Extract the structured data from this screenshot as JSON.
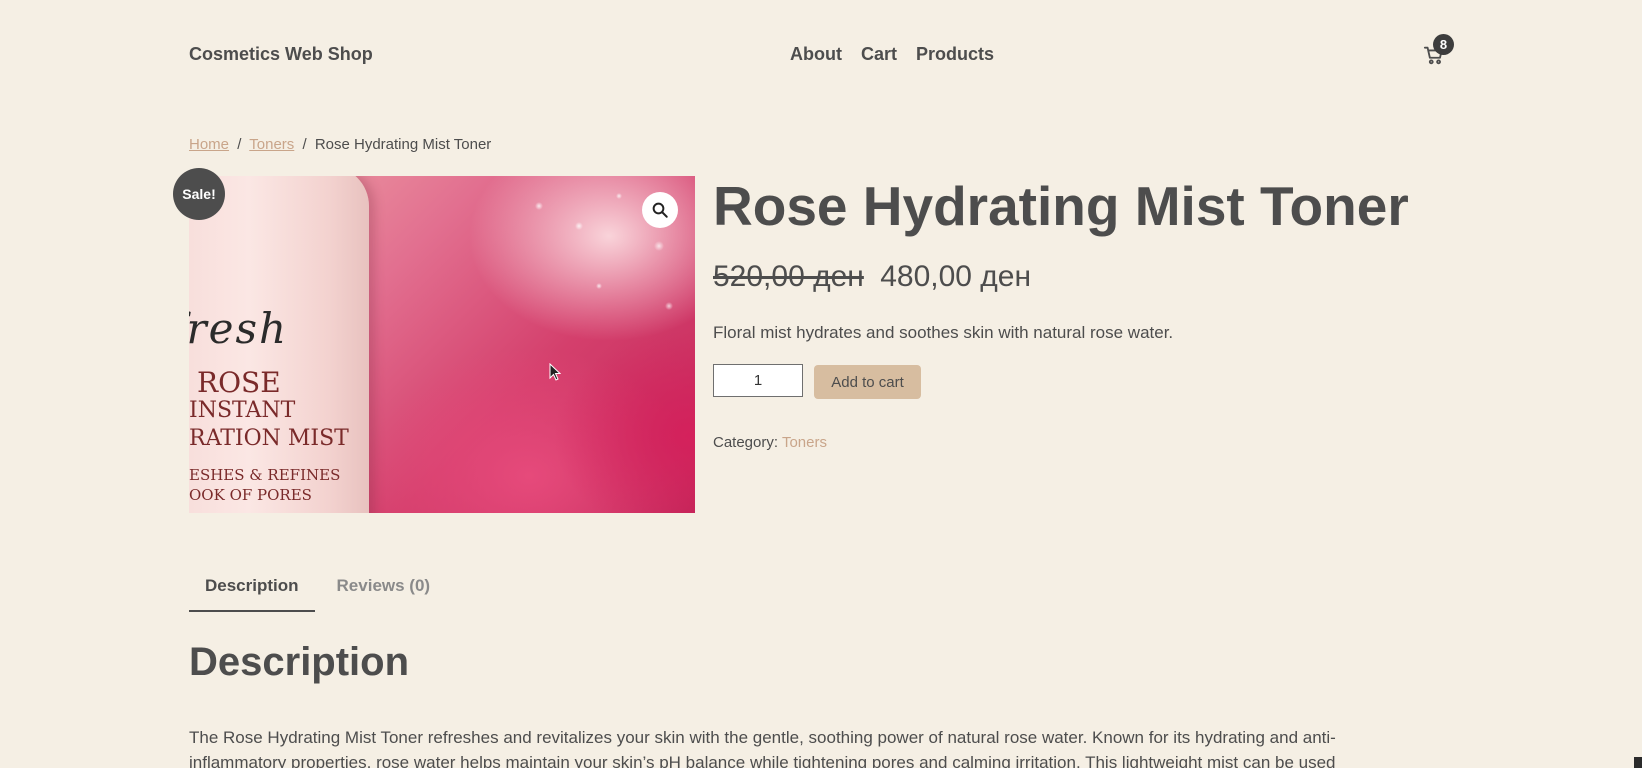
{
  "header": {
    "site_title": "Cosmetics Web Shop",
    "nav": [
      "About",
      "Cart",
      "Products"
    ],
    "cart_icon": "cart-icon",
    "cart_count": "8"
  },
  "breadcrumb": {
    "home": "Home",
    "category": "Toners",
    "separator": "/",
    "current": "Rose Hydrating Mist Toner"
  },
  "gallery": {
    "sale_badge": "Sale!",
    "zoom_icon": "magnifier-icon",
    "bottle_lines": [
      "fresh",
      "ROSE",
      "INSTANT",
      "RATION MIST",
      "ESHES & REFINES",
      "OOK OF PORES"
    ]
  },
  "product": {
    "title": "Rose Hydrating Mist Toner",
    "old_price": "520,00 ден",
    "new_price": "480,00 ден",
    "short_description": "Floral mist hydrates and soothes skin with natural rose water.",
    "quantity": "1",
    "add_to_cart": "Add to cart",
    "category_label": "Category:",
    "category_value": "Toners"
  },
  "tabs": [
    {
      "label": "Description",
      "active": true
    },
    {
      "label": "Reviews (0)",
      "active": false
    }
  ],
  "description": {
    "heading": "Description",
    "body": "The Rose Hydrating Mist Toner refreshes and revitalizes your skin with the gentle, soothing power of natural rose water. Known for its hydrating and anti-inflammatory properties, rose water helps maintain your skin’s pH balance while tightening pores and calming irritation. This lightweight mist can be used"
  },
  "colors": {
    "background": "#f5efe4",
    "text": "#4d4d4d",
    "accent": "#c9a58a",
    "button": "#d7bda0",
    "badge": "#4d4d4d"
  }
}
